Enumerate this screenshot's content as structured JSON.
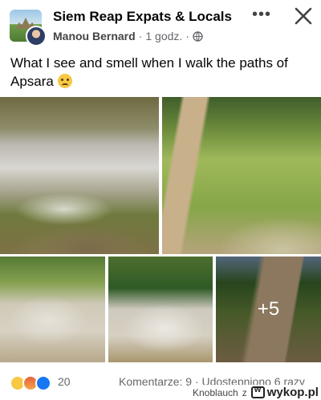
{
  "header": {
    "group_name": "Siem Reap Expats & Locals",
    "author": "Manou Bernard",
    "time": "1 godz.",
    "separator": "·",
    "more_label": "•••"
  },
  "post": {
    "text": "What I see and smell when I walk the paths of Apsara"
  },
  "gallery": {
    "more_count": "+5"
  },
  "footer": {
    "reaction_count": "20",
    "stats": "Komentarze: 9 · Udostępniono 6 razy"
  },
  "watermark": {
    "user": "Knoblauch",
    "z": "z",
    "site": "wykop.pl"
  },
  "icons": {
    "globe": "globe-icon",
    "close": "close-icon",
    "more": "more-icon"
  }
}
